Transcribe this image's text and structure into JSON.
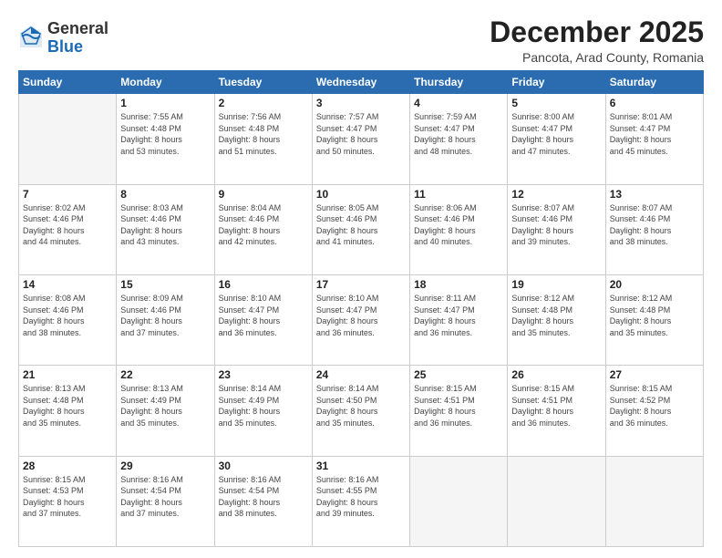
{
  "header": {
    "logo_line1": "General",
    "logo_line2": "Blue",
    "month_title": "December 2025",
    "location": "Pancota, Arad County, Romania"
  },
  "weekdays": [
    "Sunday",
    "Monday",
    "Tuesday",
    "Wednesday",
    "Thursday",
    "Friday",
    "Saturday"
  ],
  "weeks": [
    [
      {
        "day": "",
        "info": ""
      },
      {
        "day": "1",
        "info": "Sunrise: 7:55 AM\nSunset: 4:48 PM\nDaylight: 8 hours\nand 53 minutes."
      },
      {
        "day": "2",
        "info": "Sunrise: 7:56 AM\nSunset: 4:48 PM\nDaylight: 8 hours\nand 51 minutes."
      },
      {
        "day": "3",
        "info": "Sunrise: 7:57 AM\nSunset: 4:47 PM\nDaylight: 8 hours\nand 50 minutes."
      },
      {
        "day": "4",
        "info": "Sunrise: 7:59 AM\nSunset: 4:47 PM\nDaylight: 8 hours\nand 48 minutes."
      },
      {
        "day": "5",
        "info": "Sunrise: 8:00 AM\nSunset: 4:47 PM\nDaylight: 8 hours\nand 47 minutes."
      },
      {
        "day": "6",
        "info": "Sunrise: 8:01 AM\nSunset: 4:47 PM\nDaylight: 8 hours\nand 45 minutes."
      }
    ],
    [
      {
        "day": "7",
        "info": "Sunrise: 8:02 AM\nSunset: 4:46 PM\nDaylight: 8 hours\nand 44 minutes."
      },
      {
        "day": "8",
        "info": "Sunrise: 8:03 AM\nSunset: 4:46 PM\nDaylight: 8 hours\nand 43 minutes."
      },
      {
        "day": "9",
        "info": "Sunrise: 8:04 AM\nSunset: 4:46 PM\nDaylight: 8 hours\nand 42 minutes."
      },
      {
        "day": "10",
        "info": "Sunrise: 8:05 AM\nSunset: 4:46 PM\nDaylight: 8 hours\nand 41 minutes."
      },
      {
        "day": "11",
        "info": "Sunrise: 8:06 AM\nSunset: 4:46 PM\nDaylight: 8 hours\nand 40 minutes."
      },
      {
        "day": "12",
        "info": "Sunrise: 8:07 AM\nSunset: 4:46 PM\nDaylight: 8 hours\nand 39 minutes."
      },
      {
        "day": "13",
        "info": "Sunrise: 8:07 AM\nSunset: 4:46 PM\nDaylight: 8 hours\nand 38 minutes."
      }
    ],
    [
      {
        "day": "14",
        "info": "Sunrise: 8:08 AM\nSunset: 4:46 PM\nDaylight: 8 hours\nand 38 minutes."
      },
      {
        "day": "15",
        "info": "Sunrise: 8:09 AM\nSunset: 4:46 PM\nDaylight: 8 hours\nand 37 minutes."
      },
      {
        "day": "16",
        "info": "Sunrise: 8:10 AM\nSunset: 4:47 PM\nDaylight: 8 hours\nand 36 minutes."
      },
      {
        "day": "17",
        "info": "Sunrise: 8:10 AM\nSunset: 4:47 PM\nDaylight: 8 hours\nand 36 minutes."
      },
      {
        "day": "18",
        "info": "Sunrise: 8:11 AM\nSunset: 4:47 PM\nDaylight: 8 hours\nand 36 minutes."
      },
      {
        "day": "19",
        "info": "Sunrise: 8:12 AM\nSunset: 4:48 PM\nDaylight: 8 hours\nand 35 minutes."
      },
      {
        "day": "20",
        "info": "Sunrise: 8:12 AM\nSunset: 4:48 PM\nDaylight: 8 hours\nand 35 minutes."
      }
    ],
    [
      {
        "day": "21",
        "info": "Sunrise: 8:13 AM\nSunset: 4:48 PM\nDaylight: 8 hours\nand 35 minutes."
      },
      {
        "day": "22",
        "info": "Sunrise: 8:13 AM\nSunset: 4:49 PM\nDaylight: 8 hours\nand 35 minutes."
      },
      {
        "day": "23",
        "info": "Sunrise: 8:14 AM\nSunset: 4:49 PM\nDaylight: 8 hours\nand 35 minutes."
      },
      {
        "day": "24",
        "info": "Sunrise: 8:14 AM\nSunset: 4:50 PM\nDaylight: 8 hours\nand 35 minutes."
      },
      {
        "day": "25",
        "info": "Sunrise: 8:15 AM\nSunset: 4:51 PM\nDaylight: 8 hours\nand 36 minutes."
      },
      {
        "day": "26",
        "info": "Sunrise: 8:15 AM\nSunset: 4:51 PM\nDaylight: 8 hours\nand 36 minutes."
      },
      {
        "day": "27",
        "info": "Sunrise: 8:15 AM\nSunset: 4:52 PM\nDaylight: 8 hours\nand 36 minutes."
      }
    ],
    [
      {
        "day": "28",
        "info": "Sunrise: 8:15 AM\nSunset: 4:53 PM\nDaylight: 8 hours\nand 37 minutes."
      },
      {
        "day": "29",
        "info": "Sunrise: 8:16 AM\nSunset: 4:54 PM\nDaylight: 8 hours\nand 37 minutes."
      },
      {
        "day": "30",
        "info": "Sunrise: 8:16 AM\nSunset: 4:54 PM\nDaylight: 8 hours\nand 38 minutes."
      },
      {
        "day": "31",
        "info": "Sunrise: 8:16 AM\nSunset: 4:55 PM\nDaylight: 8 hours\nand 39 minutes."
      },
      {
        "day": "",
        "info": ""
      },
      {
        "day": "",
        "info": ""
      },
      {
        "day": "",
        "info": ""
      }
    ]
  ]
}
